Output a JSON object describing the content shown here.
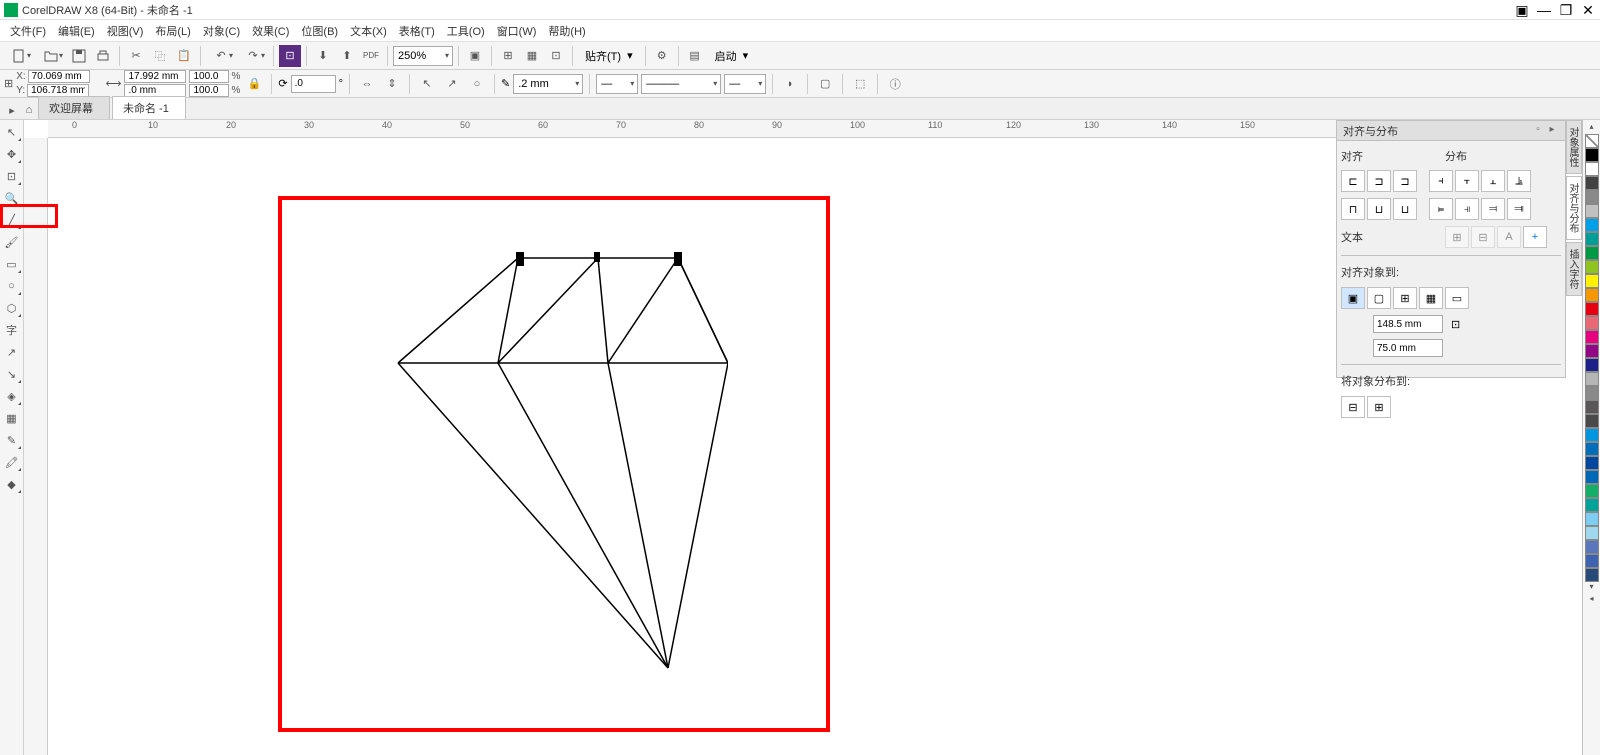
{
  "app": {
    "title": "CorelDRAW X8 (64-Bit) - 未命名 -1"
  },
  "menu": [
    "文件(F)",
    "编辑(E)",
    "视图(V)",
    "布局(L)",
    "对象(C)",
    "效果(C)",
    "位图(B)",
    "文本(X)",
    "表格(T)",
    "工具(O)",
    "窗口(W)",
    "帮助(H)"
  ],
  "toolbar": {
    "zoom": "250%",
    "snap_label": "贴齐(T)",
    "launch_label": "启动"
  },
  "propbar": {
    "x_label": "X:",
    "x_value": "70.069 mm",
    "y_label": "Y:",
    "y_value": "106.718 mm",
    "w_value": "17.992 mm",
    "h_value": ".0 mm",
    "scale_x": "100.0",
    "scale_y": "100.0",
    "pct": "%",
    "rotation": ".0",
    "outline_width": ".2 mm"
  },
  "tabs": {
    "welcome": "欢迎屏幕",
    "doc": "未命名 -1"
  },
  "ruler_ticks": [
    0,
    10,
    20,
    30,
    40,
    50,
    60,
    70,
    80,
    90,
    100,
    110,
    120,
    130,
    140,
    150
  ],
  "panel": {
    "title": "对齐与分布",
    "align_label": "对齐",
    "dist_label": "分布",
    "text_label": "文本",
    "align_to_label": "对齐对象到:",
    "dist_to_label": "将对象分布到:",
    "coord_x": "148.5 mm",
    "coord_y": "75.0 mm"
  },
  "side_tabs": [
    "对象属性",
    "对齐与分布",
    "插入字符"
  ],
  "colors": [
    "#000000",
    "#ffffff",
    "#00a0e9",
    "#009944",
    "#8fc31f",
    "#fff100",
    "#f39800",
    "#e60012",
    "#eb6100",
    "#e4007f",
    "#920783",
    "#1d2088",
    "#898989",
    "#666666",
    "#c9caca",
    "#595757",
    "#878787",
    "#b5b5b6",
    "#036eb8",
    "#00479d",
    "#0068b7",
    "#13ae67",
    "#0097e0",
    "#00a29a",
    "#7ecef4",
    "#aaaaaa"
  ]
}
